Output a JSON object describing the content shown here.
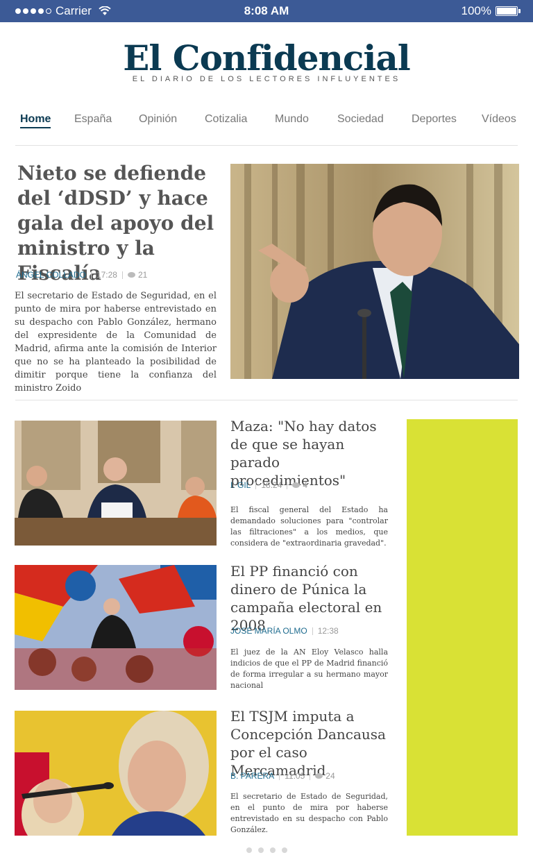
{
  "status": {
    "carrier": "Carrier",
    "time": "8:08 AM",
    "battery": "100%"
  },
  "header": {
    "logo": "El Confidencial",
    "tagline": "EL DIARIO DE LOS LECTORES INFLUYENTES"
  },
  "nav": {
    "items": [
      "Home",
      "España",
      "Opinión",
      "Cotizalia",
      "Mundo",
      "Sociedad",
      "Deportes",
      "Vídeos"
    ],
    "active": "Home"
  },
  "lead": {
    "title": "Nieto se defiende del ‘dDSD’ y hace gala del apoyo del ministro y la Fiscalía",
    "author": "ÁNGEL COLLADO",
    "time": "17:28",
    "comments": "21",
    "body": "El secretario de Estado de Seguridad, en el punto de mira por haberse entrevistado en su despacho con Pablo González, hermano del expresidente de la Comunidad de Madrid, afirma ante la comisión de Interior que no se ha planteado la posibilidad de dimitir porque tiene la confianza del ministro Zoido"
  },
  "stories": [
    {
      "title": "Maza: \"No hay datos de que se hayan parado procedimientos\"",
      "author": "I. GIL",
      "time": "18:24",
      "comments": "4",
      "body": "El fiscal general del Estado ha demandado soluciones para \"controlar las filtraciones\" a los medios, que considera de \"extraordinaria gravedad\"."
    },
    {
      "title": "El PP financió con dinero de Púnica la campaña electoral en 2008",
      "author": "JOSÉ MARÍA OLMO",
      "time": "12:38",
      "body": "El juez de la AN Eloy Velasco halla indicios de que el PP de Madrid financió de forma irregular a su hermano mayor nacional"
    },
    {
      "title": "El TSJM imputa a Concepción Dancausa por el caso Mercamadrid",
      "author": "B. PARERA",
      "time": "11:05",
      "comments": "24",
      "body": "El secretario de Estado de Seguridad, en el punto de mira por haberse entrevistado en su despacho con Pablo González."
    }
  ],
  "colors": {
    "statusbar": "#3c5a96",
    "brand": "#0b3a52",
    "ad": "#d9e135"
  }
}
